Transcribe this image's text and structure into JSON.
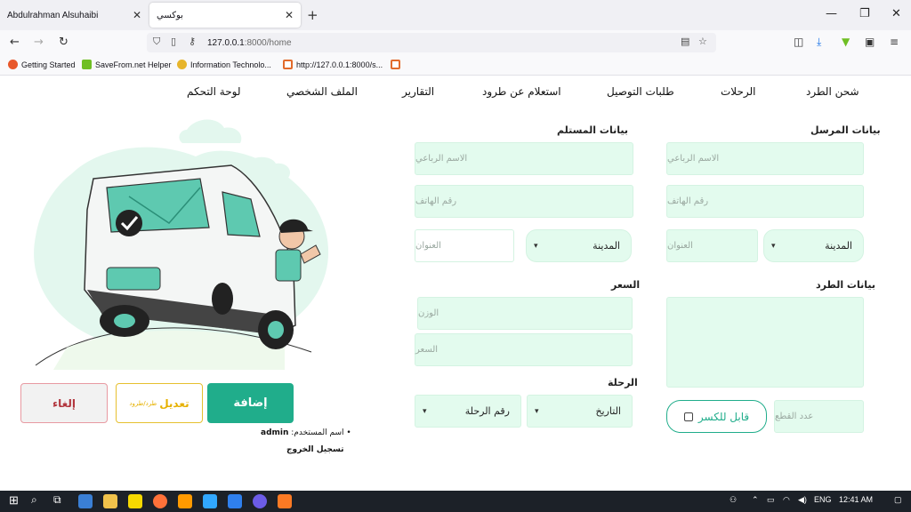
{
  "browser": {
    "tabs": [
      {
        "title": "Abdulrahman Alsuhaibi",
        "active": false
      },
      {
        "title": "بوكسي",
        "active": true
      }
    ],
    "url_host": "127.0.0.1",
    "url_rest": ":8000/home",
    "bookmarks": [
      {
        "label": "Getting Started",
        "color": "#e8572a"
      },
      {
        "label": "SaveFrom.net Helper",
        "color": "#6fbf24"
      },
      {
        "label": "Information Technolo...",
        "color": "#e7b52c"
      },
      {
        "label": "http://127.0.0.1:8000/s...",
        "color": "#e26b2c"
      },
      {
        "label": "",
        "color": "#e26b2c"
      }
    ]
  },
  "nav": {
    "items": [
      {
        "label": "شحن الطرد"
      },
      {
        "label": "الرحلات"
      },
      {
        "label": "طلبات التوصيل"
      },
      {
        "label": "استعلام عن طرود"
      },
      {
        "label": "التقارير"
      },
      {
        "label": "الملف الشخصي"
      },
      {
        "label": "لوحة التحكم"
      }
    ]
  },
  "sender": {
    "title": "بيانات المرسل",
    "name_placeholder": "الاسم الرباعي",
    "phone_placeholder": "رقم الهاتف",
    "city_label": "المدينة",
    "address_placeholder": "العنوان"
  },
  "receiver": {
    "title": "بيانات المستلم",
    "name_placeholder": "الاسم الرباعي",
    "phone_placeholder": "رقم الهاتف",
    "city_label": "المدينة",
    "address_placeholder": "العنوان"
  },
  "parcel": {
    "title": "بيانات الطرد",
    "pieces_placeholder": "عدد القطع",
    "fragile_label": "قابل للكسر"
  },
  "price": {
    "title": "السعر",
    "weight_placeholder": "الوزن",
    "price_placeholder": "السعر"
  },
  "trip": {
    "title": "الرحلة",
    "date_label": "التاريخ",
    "trip_number_label": "رقم الرحلة"
  },
  "actions": {
    "add": "إضافة",
    "edit": "تعديل",
    "edit_sub": "طرد/طرود",
    "cancel": "إلغاء"
  },
  "user": {
    "label": "اسم المستخدم:",
    "name": "admin",
    "logout": "تسجيل الخروج"
  },
  "system": {
    "language": "ENG",
    "time": "12:41 AM"
  },
  "colors": {
    "accent": "#20ad8b",
    "field_bg": "#e3fbee",
    "edit": "#e6b100",
    "cancel": "#b2363e"
  }
}
